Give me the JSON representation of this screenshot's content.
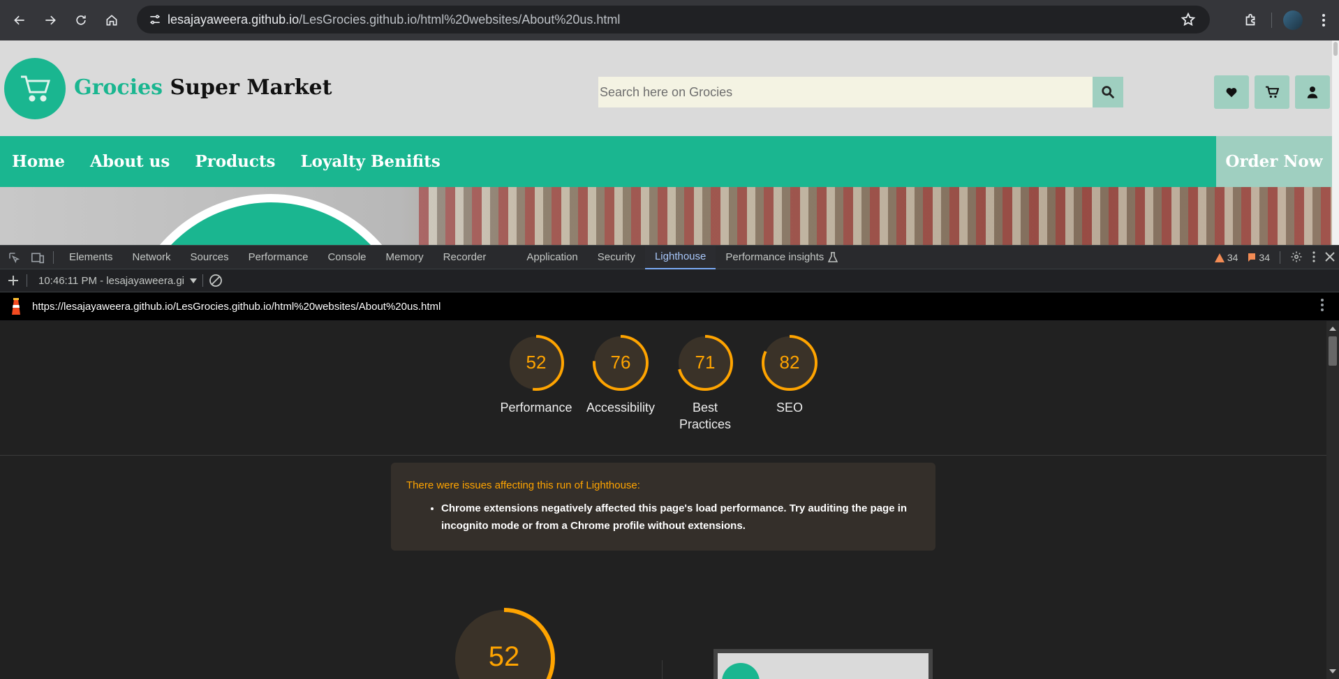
{
  "browser": {
    "url_host": "lesajayaweera.github.io",
    "url_path": "/LesGrocies.github.io/html%20websites/About%20us.html"
  },
  "site": {
    "brand_green": "Grocies",
    "brand_black": "Super Market",
    "search_placeholder": "Search here on Grocies",
    "nav": [
      "Home",
      "About us",
      "Products",
      "Loyalty Benifits"
    ],
    "order_now": "Order Now",
    "accent_color": "#1ab690"
  },
  "devtools": {
    "tabs": [
      "Elements",
      "Network",
      "Sources",
      "Performance",
      "Console",
      "Memory",
      "Recorder",
      "Application",
      "Security",
      "Lighthouse",
      "Performance insights"
    ],
    "active_tab": "Lighthouse",
    "warnings_count": "34",
    "issues_count": "34",
    "report_selector": "10:46:11 PM - lesajayaweera.gi",
    "report_url": "https://lesajayaweera.github.io/LesGrocies.github.io/html%20websites/About%20us.html"
  },
  "lighthouse": {
    "scores": [
      {
        "label": "Performance",
        "value": 52
      },
      {
        "label": "Accessibility",
        "value": 76
      },
      {
        "label": "Best Practices",
        "value": 71
      },
      {
        "label": "SEO",
        "value": 82
      }
    ],
    "score_color": "#ffa400",
    "warning_title": "There were issues affecting this run of Lighthouse:",
    "warning_item": "Chrome extensions negatively affected this page's load performance. Try auditing the page in incognito mode or from a Chrome profile without extensions.",
    "big_score": 52
  }
}
